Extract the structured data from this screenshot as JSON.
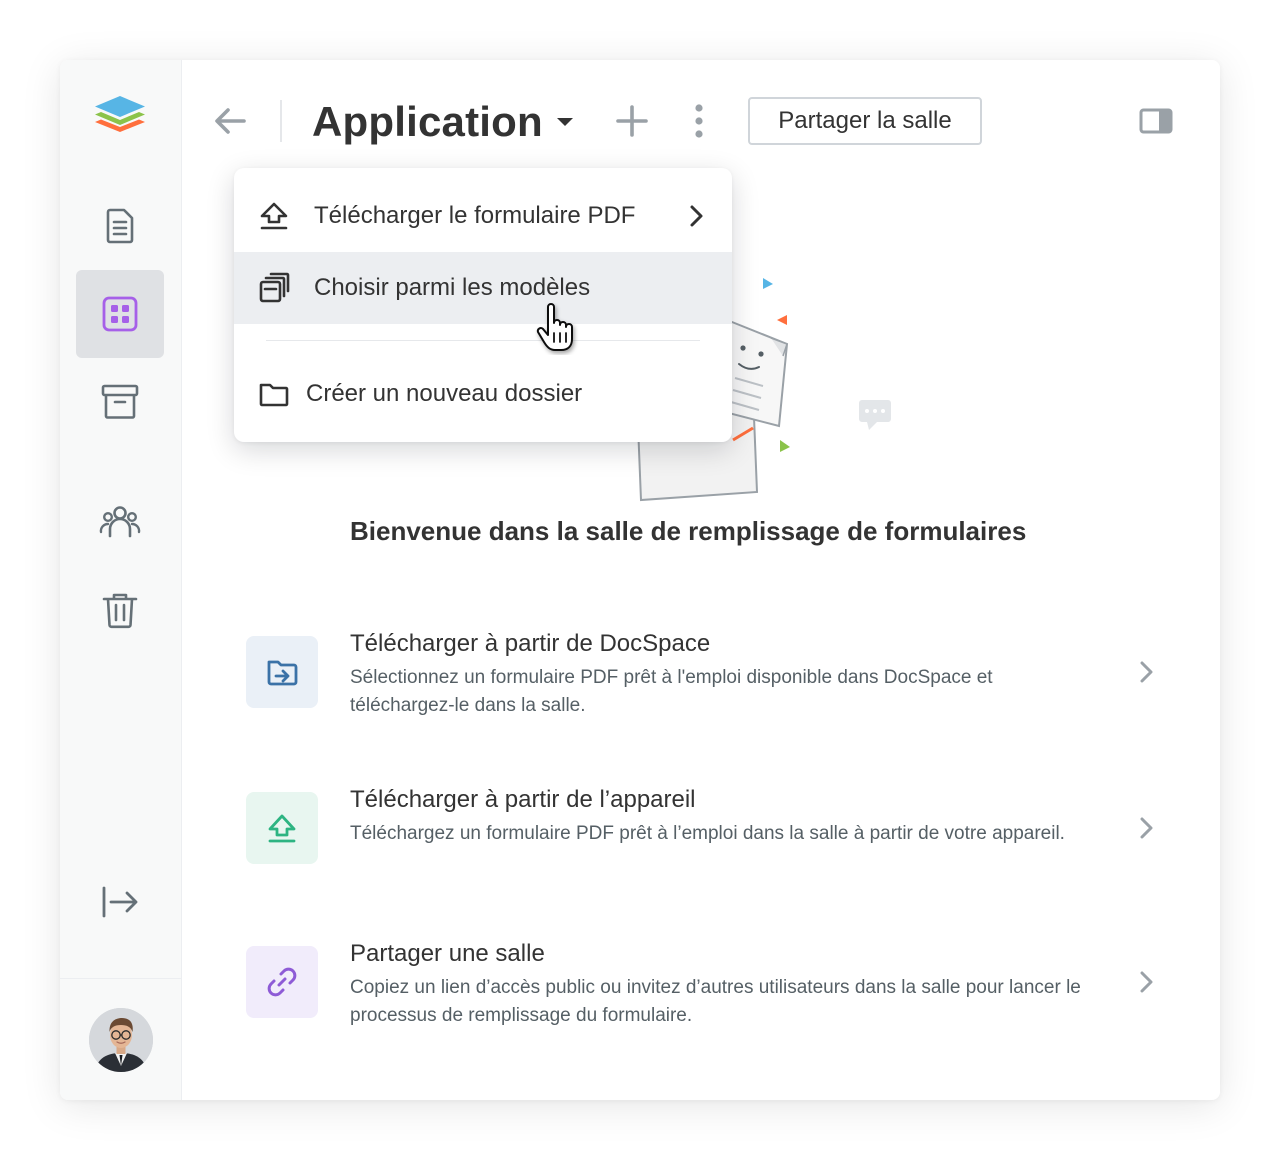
{
  "header": {
    "title": "Application",
    "share_label": "Partager la salle"
  },
  "menu": {
    "items": [
      {
        "label": "Télécharger le formulaire PDF",
        "icon": "upload-icon",
        "has_submenu": true
      },
      {
        "label": "Choisir parmi les modèles",
        "icon": "templates-icon",
        "hovered": true
      },
      {
        "label": "Créer un nouveau dossier",
        "icon": "folder-icon"
      }
    ]
  },
  "sidebar": {
    "items": [
      {
        "icon": "document-icon"
      },
      {
        "icon": "rooms-icon",
        "active": true
      },
      {
        "icon": "archive-icon"
      },
      {
        "icon": "people-icon"
      },
      {
        "icon": "trash-icon"
      },
      {
        "icon": "logout-icon"
      }
    ]
  },
  "main": {
    "welcome": "Bienvenue dans la salle de remplissage de formulaires",
    "options": [
      {
        "title": "Télécharger à partir de DocSpace",
        "description": "Sélectionnez un formulaire PDF prêt à l'emploi disponible dans DocSpace et téléchargez-le dans la salle.",
        "icon": "docspace-upload-icon",
        "color": "#3b72a7"
      },
      {
        "title": "Télécharger à partir de l’appareil",
        "description": "Téléchargez un formulaire PDF prêt à l’emploi dans la salle à partir de votre appareil.",
        "icon": "device-upload-icon",
        "color": "#2db482"
      },
      {
        "title": "Partager une salle",
        "description": "Copiez un lien d’accès public ou invitez d’autres utilisateurs dans la salle pour lancer le processus de remplissage du formulaire.",
        "icon": "link-icon",
        "color": "#8e5bd6"
      }
    ]
  },
  "colors": {
    "accent_purple": "#a660e8",
    "icon_gray": "#657077",
    "logo_blue": "#57b5e5",
    "logo_green": "#8bc34a",
    "logo_orange": "#ff6f3d"
  }
}
